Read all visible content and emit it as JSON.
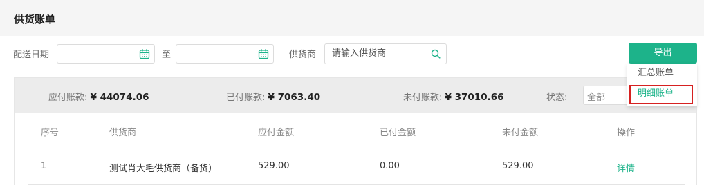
{
  "page": {
    "title": "供货账单"
  },
  "filters": {
    "delivery_date_label": "配送日期",
    "to_label": "至",
    "start_date_value": "",
    "end_date_value": "",
    "supplier_label": "供货商",
    "supplier_placeholder": "请输入供货商",
    "export_label": "导出"
  },
  "export_menu": {
    "items": [
      "汇总账单",
      "明细账单"
    ],
    "highlighted": "明细账单"
  },
  "summary": {
    "payable_label": "应付账款:",
    "payable_value": "¥ 44074.06",
    "paid_label": "已付账款:",
    "paid_value": "¥ 7063.40",
    "unpaid_label": "未付账款:",
    "unpaid_value": "¥ 37010.66",
    "status_label": "状态:",
    "status_value": "全部"
  },
  "table": {
    "columns": [
      "序号",
      "供货商",
      "应付金额",
      "已付金额",
      "未付金额",
      "操作"
    ],
    "rows": [
      {
        "index": "1",
        "supplier": "测试肖大毛供货商（备货）",
        "payable": "529.00",
        "paid": "0.00",
        "unpaid": "529.00",
        "action": "详情"
      }
    ]
  },
  "colors": {
    "accent": "#1db38a",
    "highlight_border": "#d62121"
  },
  "icons": {
    "date": "calendar-icon",
    "search": "search-icon"
  }
}
